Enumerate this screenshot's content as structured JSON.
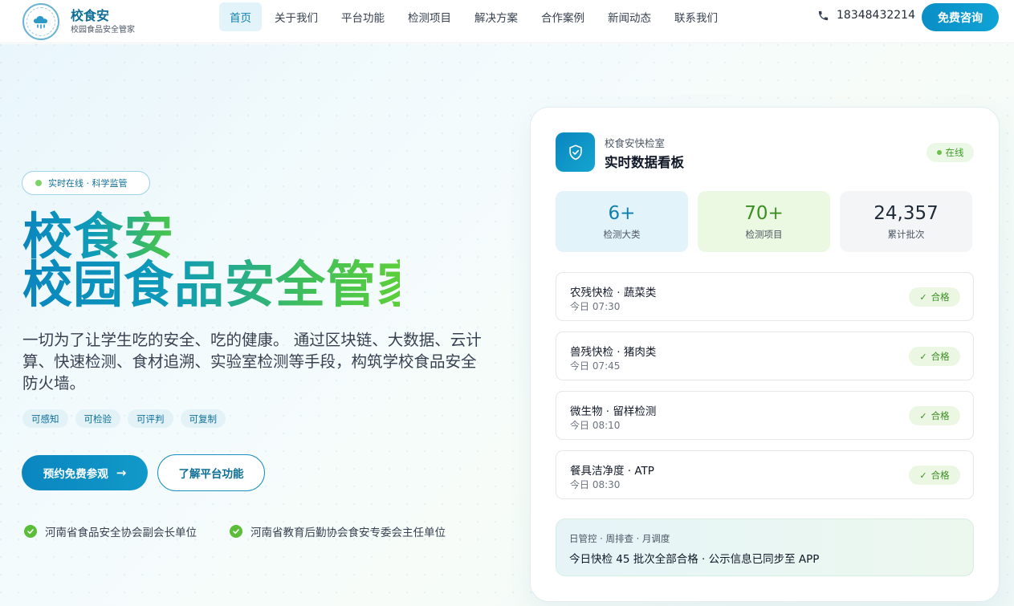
{
  "header": {
    "brand_name": "校食安",
    "brand_sub": "校园食品安全管家",
    "nav": [
      "首页",
      "关于我们",
      "平台功能",
      "检测项目",
      "解决方案",
      "合作案例",
      "新闻动态",
      "联系我们"
    ],
    "active_nav": "首页",
    "phone": "18348432214",
    "consult_label": "免费咨询"
  },
  "hero": {
    "badge": "实时在线 · 科学监管",
    "title_line1": "校食安",
    "title_line2": "校园食品安全管家",
    "description": "一切为了让学生吃的安全、吃的健康。 通过区块链、大数据、云计算、快速检测、食材追溯、实验室检测等手段，构筑学校食品安全防火墙。",
    "tags": [
      "可感知",
      "可检验",
      "可评判",
      "可复制"
    ],
    "primary_button": "预约免费参观",
    "secondary_button": "了解平台功能",
    "credentials": [
      "河南省食品安全协会副会长单位",
      "河南省教育后勤协会食安专委会主任单位"
    ]
  },
  "dashboard": {
    "subtitle": "校食安快检室",
    "title": "实时数据看板",
    "status": "在线",
    "stats": [
      {
        "value": "6+",
        "label": "检测大类"
      },
      {
        "value": "70+",
        "label": "检测项目"
      },
      {
        "value": "24,357",
        "label": "累计批次"
      }
    ],
    "checks": [
      {
        "name": "农残快检 · 蔬菜类",
        "time": "今日 07:30",
        "result": "合格"
      },
      {
        "name": "兽残快检 · 猪肉类",
        "time": "今日 07:45",
        "result": "合格"
      },
      {
        "name": "微生物 · 留样检测",
        "time": "今日 08:10",
        "result": "合格"
      },
      {
        "name": "餐具洁净度 · ATP",
        "time": "今日 08:30",
        "result": "合格"
      }
    ],
    "summary_line1": "日管控 · 周排查 · 月调度",
    "summary_line2": "今日快检 45 批次全部合格 · 公示信息已同步至 APP"
  },
  "colors": {
    "primary": "#0a86bf",
    "accent_green": "#5ccf3a",
    "pass_green": "#3c8f24"
  }
}
